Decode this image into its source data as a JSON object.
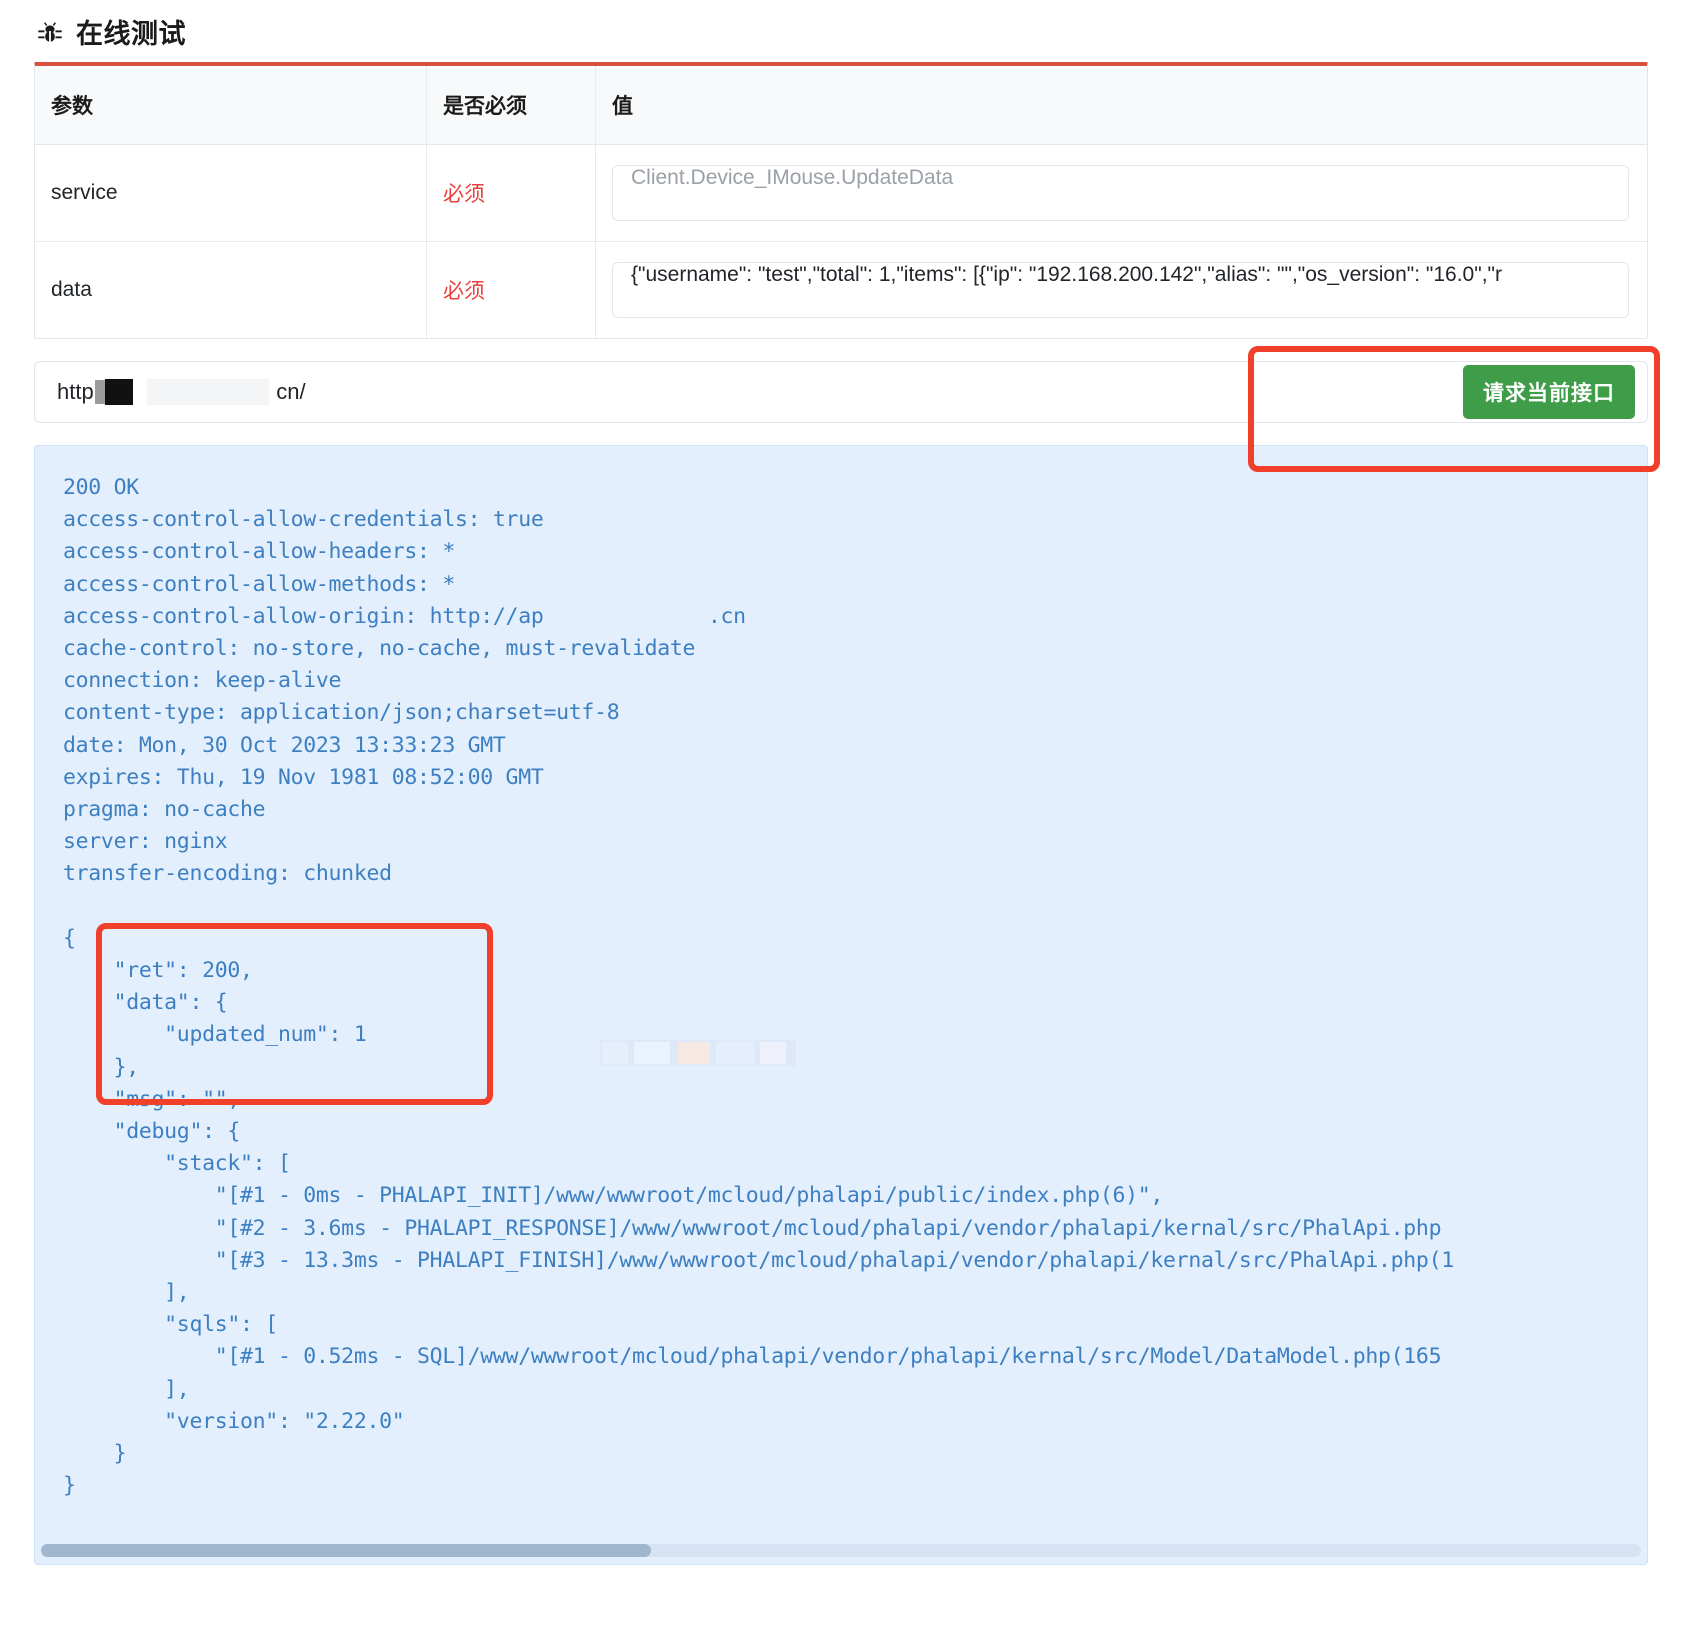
{
  "header": {
    "icon": "bug-icon",
    "title": "在线测试"
  },
  "param_table": {
    "columns": [
      "参数",
      "是否必须",
      "值"
    ],
    "rows": [
      {
        "name": "service",
        "required_label": "必须",
        "value": "Client.Device_IMouse.UpdateData",
        "is_placeholder": true
      },
      {
        "name": "data",
        "required_label": "必须",
        "value": "{\"username\": \"test\",\"total\": 1,\"items\": [{\"ip\": \"192.168.200.142\",\"alias\": \"\",\"os_version\": \"16.0\",\"r",
        "is_placeholder": false
      }
    ]
  },
  "request_bar": {
    "url_prefix": "http://a",
    "url_suffix": "cn/",
    "url_redacted": true,
    "submit_label": "请求当前接口",
    "submit_color": "#3f9c48"
  },
  "annotations": {
    "button_highlight_color": "#f0402a",
    "json_highlight_color": "#f0402a"
  },
  "response": {
    "status_line": "200 OK",
    "headers_text": "access-control-allow-credentials: true\naccess-control-allow-headers: *\naccess-control-allow-methods: *\naccess-control-allow-origin: http://ap             .cn\ncache-control: no-store, no-cache, must-revalidate\nconnection: keep-alive\ncontent-type: application/json;charset=utf-8\ndate: Mon, 30 Oct 2023 13:33:23 GMT\nexpires: Thu, 19 Nov 1981 08:52:00 GMT\npragma: no-cache\nserver: nginx\ntransfer-encoding: chunked",
    "body_text": "{\n    \"ret\": 200,\n    \"data\": {\n        \"updated_num\": 1\n    },\n    \"msg\": \"\",\n    \"debug\": {\n        \"stack\": [\n            \"[#1 - 0ms - PHALAPI_INIT]/www/wwwroot/mcloud/phalapi/public/index.php(6)\",\n            \"[#2 - 3.6ms - PHALAPI_RESPONSE]/www/wwwroot/mcloud/phalapi/vendor/phalapi/kernal/src/PhalApi.php\n            \"[#3 - 13.3ms - PHALAPI_FINISH]/www/wwwroot/mcloud/phalapi/vendor/phalapi/kernal/src/PhalApi.php(1\n        ],\n        \"sqls\": [\n            \"[#1 - 0.52ms - SQL]/www/wwwroot/mcloud/phalapi/vendor/phalapi/kernal/src/Model/DataModel.php(165\n        ],\n        \"version\": \"2.22.0\"\n    }\n}",
    "text_color": "#3d7fc1",
    "background_color": "#e3effc",
    "scroll_position": "left"
  },
  "response_json": {
    "ret": 200,
    "data": {
      "updated_num": 1
    },
    "msg": "",
    "debug": {
      "stack": [
        "[#1 - 0ms - PHALAPI_INIT]/www/wwwroot/mcloud/phalapi/public/index.php(6)",
        "[#2 - 3.6ms - PHALAPI_RESPONSE]/www/wwwroot/mcloud/phalapi/vendor/phalapi/kernal/src/PhalApi.php",
        "[#3 - 13.3ms - PHALAPI_FINISH]/www/wwwroot/mcloud/phalapi/vendor/phalapi/kernal/src/PhalApi.php(1"
      ],
      "sqls": [
        "[#1 - 0.52ms - SQL]/www/wwwroot/mcloud/phalapi/vendor/phalapi/kernal/src/Model/DataModel.php(165"
      ],
      "version": "2.22.0"
    }
  }
}
